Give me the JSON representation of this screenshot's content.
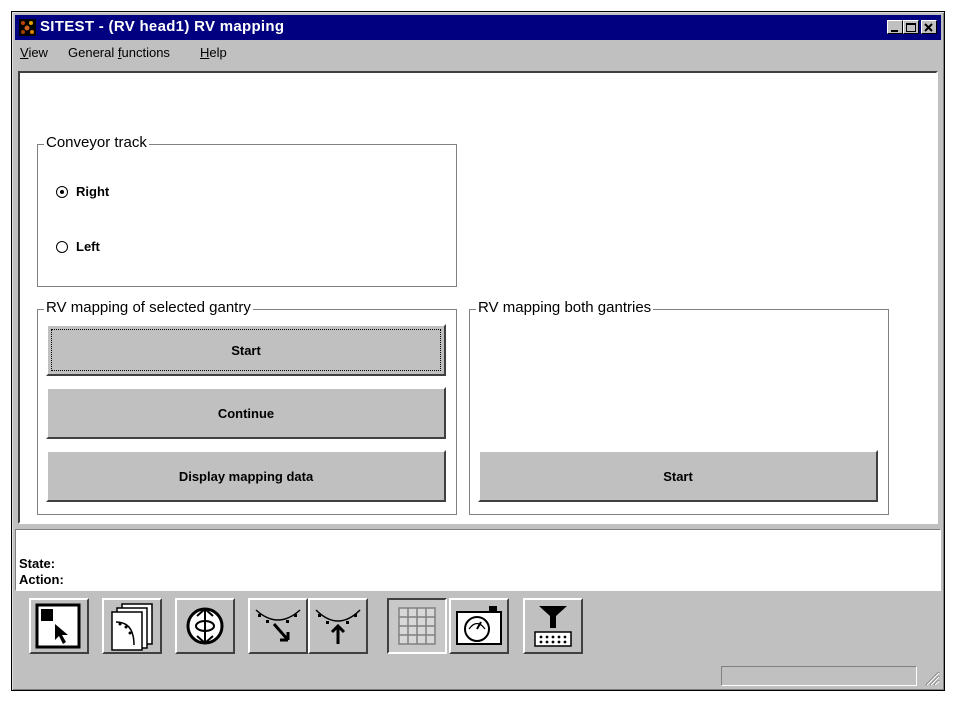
{
  "window": {
    "title": "SITEST - (RV head1) RV mapping"
  },
  "menu": [
    {
      "label": "View",
      "underline": "V"
    },
    {
      "label": "General functions",
      "underline": "f"
    },
    {
      "label": "Help",
      "underline": "H"
    }
  ],
  "conveyor": {
    "title": "Conveyor track",
    "right_label": "Right",
    "left_label": "Left",
    "selected": "Right"
  },
  "selected_gantry": {
    "title": "RV mapping of selected gantry",
    "start_label": "Start",
    "continue_label": "Continue",
    "display_label": "Display mapping data"
  },
  "both_gantries": {
    "title": "RV mapping both gantries",
    "start_label": "Start"
  },
  "status": {
    "state_label": "State:",
    "action_label": "Action:"
  },
  "toolbar_icons": [
    "select-pointer-icon",
    "stacked-pages-icon",
    "rotate-icon",
    "nozzle-move-down-icon",
    "nozzle-pick-icon",
    "grid-icon",
    "camera-gauge-icon",
    "feeder-icon"
  ]
}
